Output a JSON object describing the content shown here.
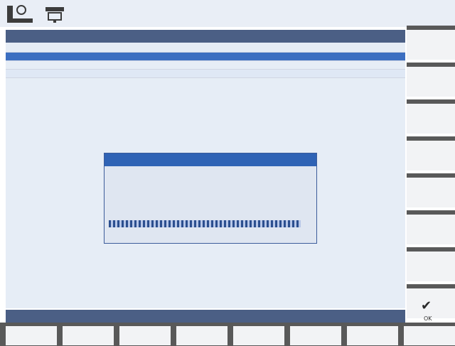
{
  "top": {
    "icons": [
      "machine-icon",
      "spindle-icon"
    ],
    "clock": {
      "line1": "",
      "line2": ""
    }
  },
  "panel": {
    "title": "",
    "rows": [
      {
        "label": "",
        "value": ""
      },
      {
        "label": "",
        "value": ""
      },
      {
        "label": "",
        "value": ""
      },
      {
        "label": "",
        "value": ""
      }
    ],
    "selected_index": 1
  },
  "dialog": {
    "title": "",
    "message_line1": "",
    "message_line2": "",
    "progress": 1.0,
    "progress_label": ""
  },
  "status": {
    "text": ""
  },
  "softkeys": {
    "right": [
      "",
      "",
      "",
      "",
      "",
      "",
      "",
      "OK"
    ],
    "bottom": [
      "",
      "",
      "",
      "",
      "",
      "",
      "",
      ""
    ]
  },
  "colors": {
    "accent": "#3c6fc1",
    "panel": "#e6edf6",
    "status": "#4b5f85"
  }
}
